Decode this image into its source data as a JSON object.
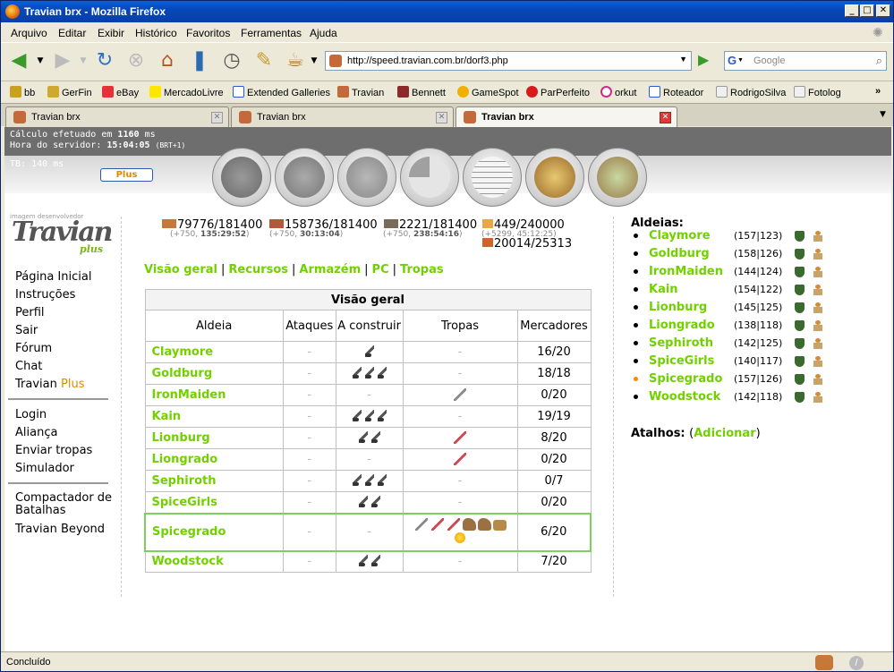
{
  "window": {
    "title": "Travian brx - Mozilla Firefox"
  },
  "menu": [
    "Arquivo",
    "Editar",
    "Exibir",
    "Histórico",
    "Favoritos",
    "Ferramentas",
    "Ajuda"
  ],
  "address": {
    "url": "http://speed.travian.com.br/dorf3.php"
  },
  "search": {
    "placeholder": "Google"
  },
  "bookmarks": [
    "bb",
    "GerFin",
    "eBay",
    "MercadoLivre",
    "Extended Galleries",
    "Travian",
    "Bennett",
    "GameSpot",
    "ParPerfeito",
    "orkut",
    "Roteador",
    "RodrigoSilva",
    "Fotolog"
  ],
  "tabs": [
    "Travian brx",
    "Travian brx",
    "Travian brx"
  ],
  "server": {
    "calc": "Cálculo efetuado em",
    "calc_ms": "1160",
    "calc_unit": "ms",
    "time_label": "Hora do servidor:",
    "time": "15:04:05",
    "tz": "(BRT+1)",
    "tb": "TB: 140 ms"
  },
  "plus_button": "Plus",
  "logo": {
    "small": "imagem desenvolvedor",
    "main": "Travian",
    "sub": "plus"
  },
  "leftnav": {
    "group1": [
      "Página Inicial",
      "Instruções",
      "Perfil",
      "Sair",
      "Fórum",
      "Chat"
    ],
    "travian_plus": "Travian",
    "plus_word": "Plus",
    "group2": [
      "Login",
      "Aliança",
      "Enviar tropas",
      "Simulador"
    ],
    "group3_a": "Compactador de Batalhas",
    "group3_b": "Travian Beyond"
  },
  "resources": {
    "wood": "79776/181400",
    "wood_sub": "(+750,",
    "wood_time": "135:29:52",
    "wood_close": ")",
    "clay": "158736/181400",
    "clay_sub": "(+750,",
    "clay_time": "30:13:04",
    "clay_close": ")",
    "iron": "2221/181400",
    "iron_sub": "(+750,",
    "iron_time": "238:54:16",
    "iron_close": ")",
    "crop": "449/240000",
    "crop_sub": "(+5299, 45:12:25)",
    "crop_use": "20014/25313"
  },
  "submenu": [
    "Visão geral",
    "Recursos",
    "Armazém",
    "PC",
    "Tropas"
  ],
  "table": {
    "caption": "Visão geral",
    "headers": [
      "Aldeia",
      "Ataques",
      "A construir",
      "Tropas",
      "Mercadores"
    ],
    "rows": [
      {
        "name": "Claymore",
        "attacks": "-",
        "build": 1,
        "troops": "-",
        "merchants": "16/20"
      },
      {
        "name": "Goldburg",
        "attacks": "-",
        "build": 3,
        "troops": "-",
        "merchants": "18/18"
      },
      {
        "name": "IronMaiden",
        "attacks": "-",
        "build": 0,
        "troops": "sword-gray",
        "merchants": "0/20"
      },
      {
        "name": "Kain",
        "attacks": "-",
        "build": 3,
        "troops": "-",
        "merchants": "19/19"
      },
      {
        "name": "Lionburg",
        "attacks": "-",
        "build": 2,
        "troops": "sword-red",
        "merchants": "8/20"
      },
      {
        "name": "Liongrado",
        "attacks": "-",
        "build": 0,
        "troops": "sword-red",
        "merchants": "0/20"
      },
      {
        "name": "Sephiroth",
        "attacks": "-",
        "build": 3,
        "troops": "-",
        "merchants": "0/7"
      },
      {
        "name": "SpiceGirls",
        "attacks": "-",
        "build": 2,
        "troops": "-",
        "merchants": "0/20"
      },
      {
        "name": "Spicegrado",
        "attacks": "-",
        "build": 0,
        "troops": "many",
        "merchants": "6/20"
      },
      {
        "name": "Woodstock",
        "attacks": "-",
        "build": 2,
        "troops": "-",
        "merchants": "7/20"
      }
    ]
  },
  "villages": {
    "title": "Aldeias:",
    "list": [
      {
        "name": "Claymore",
        "coords": "(157|123)"
      },
      {
        "name": "Goldburg",
        "coords": "(158|126)"
      },
      {
        "name": "IronMaiden",
        "coords": "(144|124)"
      },
      {
        "name": "Kain",
        "coords": "(154|122)"
      },
      {
        "name": "Lionburg",
        "coords": "(145|125)"
      },
      {
        "name": "Liongrado",
        "coords": "(138|118)"
      },
      {
        "name": "Sephiroth",
        "coords": "(142|125)"
      },
      {
        "name": "SpiceGirls",
        "coords": "(140|117)"
      },
      {
        "name": "Spicegrado",
        "coords": "(157|126)"
      },
      {
        "name": "Woodstock",
        "coords": "(142|118)"
      }
    ],
    "active_index": 8
  },
  "shortcuts": {
    "label": "Atalhos:",
    "link": "Adicionar",
    "open": "(",
    "close": ")"
  },
  "status": "Concluído",
  "colors": {
    "link_green": "#71d000",
    "title_blue": "#0847b8"
  }
}
